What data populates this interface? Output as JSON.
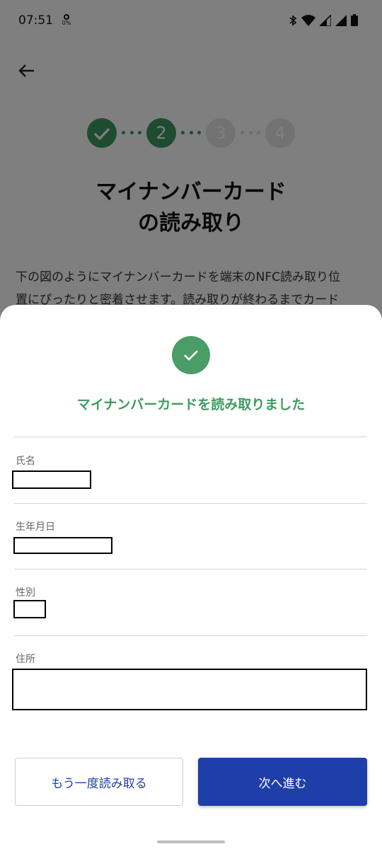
{
  "status_bar": {
    "time": "07:51",
    "data_usage": "0%"
  },
  "background": {
    "title_line1": "マイナンバーカード",
    "title_line2": "の読み取り",
    "body_line1": "下の図のようにマイナンバーカードを端末のNFC読み取り位",
    "body_line2": "置にぴったりと密着させます。読み取りが終わるまでカード",
    "steps": [
      {
        "label": "",
        "state": "done"
      },
      {
        "label": "2",
        "state": "active"
      },
      {
        "label": "3",
        "state": "todo"
      },
      {
        "label": "4",
        "state": "todo"
      }
    ]
  },
  "sheet": {
    "success_message": "マイナンバーカードを読み取りました",
    "fields": {
      "name_label": "氏名",
      "birthdate_label": "生年月日",
      "gender_label": "性別",
      "address_label": "住所"
    },
    "buttons": {
      "reread_label": "もう一度読み取る",
      "next_label": "次へ進む"
    }
  },
  "colors": {
    "success_green": "#3f9a62",
    "primary_blue": "#1f3fa8",
    "secondary_text_blue": "#2340a8"
  }
}
